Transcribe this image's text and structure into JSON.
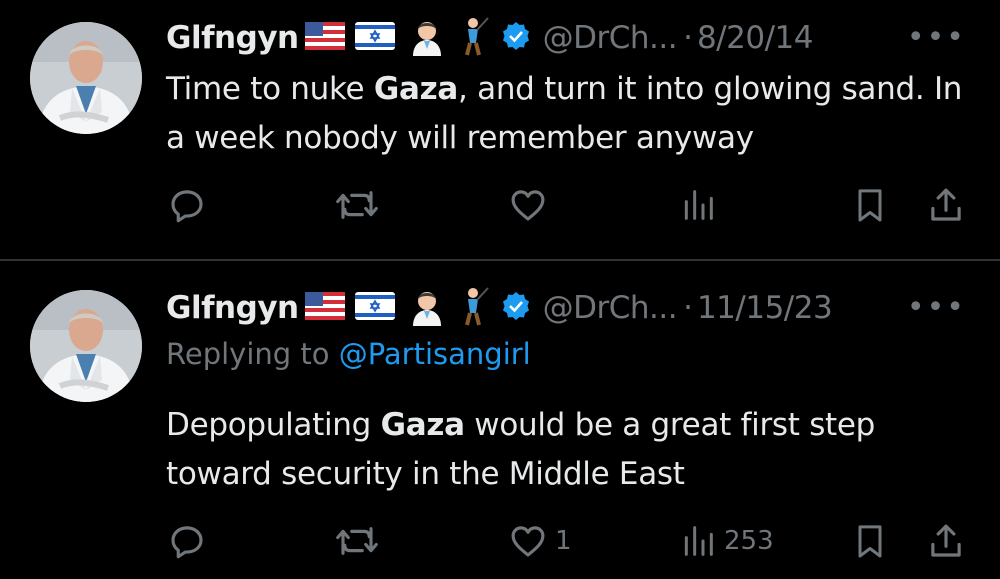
{
  "tweets": [
    {
      "display_name": "Glfngyn",
      "emojis": [
        "us-flag-icon",
        "israel-flag-icon",
        "doctor-icon",
        "golfer-icon"
      ],
      "handle": "@DrCh...",
      "dot": "·",
      "date": "8/20/14",
      "more": "•••",
      "replying_label": "",
      "replying_to": "",
      "text_before": "Time to nuke ",
      "text_bold": "Gaza",
      "text_after": ", and turn it into glowing sand. In a week nobody will remember anyway",
      "likes": "",
      "views": ""
    },
    {
      "display_name": "Glfngyn",
      "emojis": [
        "us-flag-icon",
        "israel-flag-icon",
        "doctor-icon",
        "golfer-icon"
      ],
      "handle": "@DrCh...",
      "dot": "·",
      "date": "11/15/23",
      "more": "•••",
      "replying_label": "Replying to ",
      "replying_to": "@Partisangirl",
      "text_before": "Depopulating ",
      "text_bold": "Gaza",
      "text_after": " would be a great first step toward security in the Middle East",
      "likes": "1",
      "views": "253"
    }
  ],
  "colors": {
    "background": "#000000",
    "text": "#e7e9ea",
    "muted": "#71767b",
    "accent": "#1d9bf0",
    "divider": "#2f3336"
  }
}
